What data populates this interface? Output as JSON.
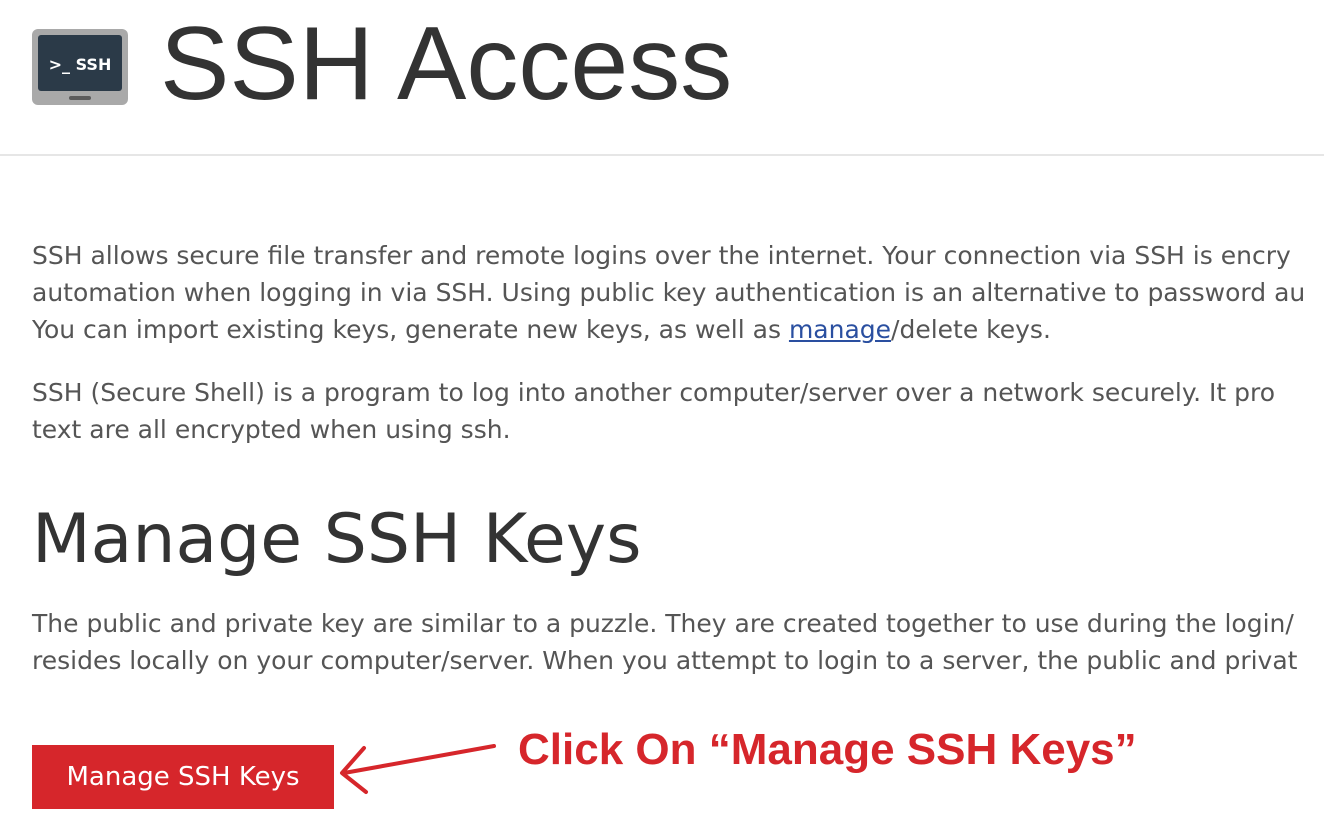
{
  "header": {
    "icon_label": ">_ SSH",
    "title": "SSH Access"
  },
  "intro": {
    "line1": "SSH allows secure file transfer and remote logins over the internet. Your connection via SSH is encry",
    "line2": "automation when logging in via SSH. Using public key authentication is an alternative to password au",
    "line3_before": "You can import existing keys, generate new keys, as well as ",
    "line3_link": "manage",
    "line3_after": "/delete keys."
  },
  "about": {
    "line1": "SSH (Secure Shell) is a program to log into another computer/server over a network securely. It pro",
    "line2": "text are all encrypted when using ssh."
  },
  "manage_section": {
    "title": "Manage SSH Keys",
    "line1": "The public and private key are similar to a puzzle. They are created together to use during the login/",
    "line2": "resides locally on your computer/server. When you attempt to login to a server, the public and privat",
    "button_label": "Manage SSH Keys"
  },
  "annotation": {
    "text": "Click On “Manage SSH Keys”",
    "color": "#d6262b"
  },
  "colors": {
    "button_bg": "#d6262b",
    "link": "#2a4fa0",
    "body_text": "#555555",
    "heading_text": "#333333"
  }
}
